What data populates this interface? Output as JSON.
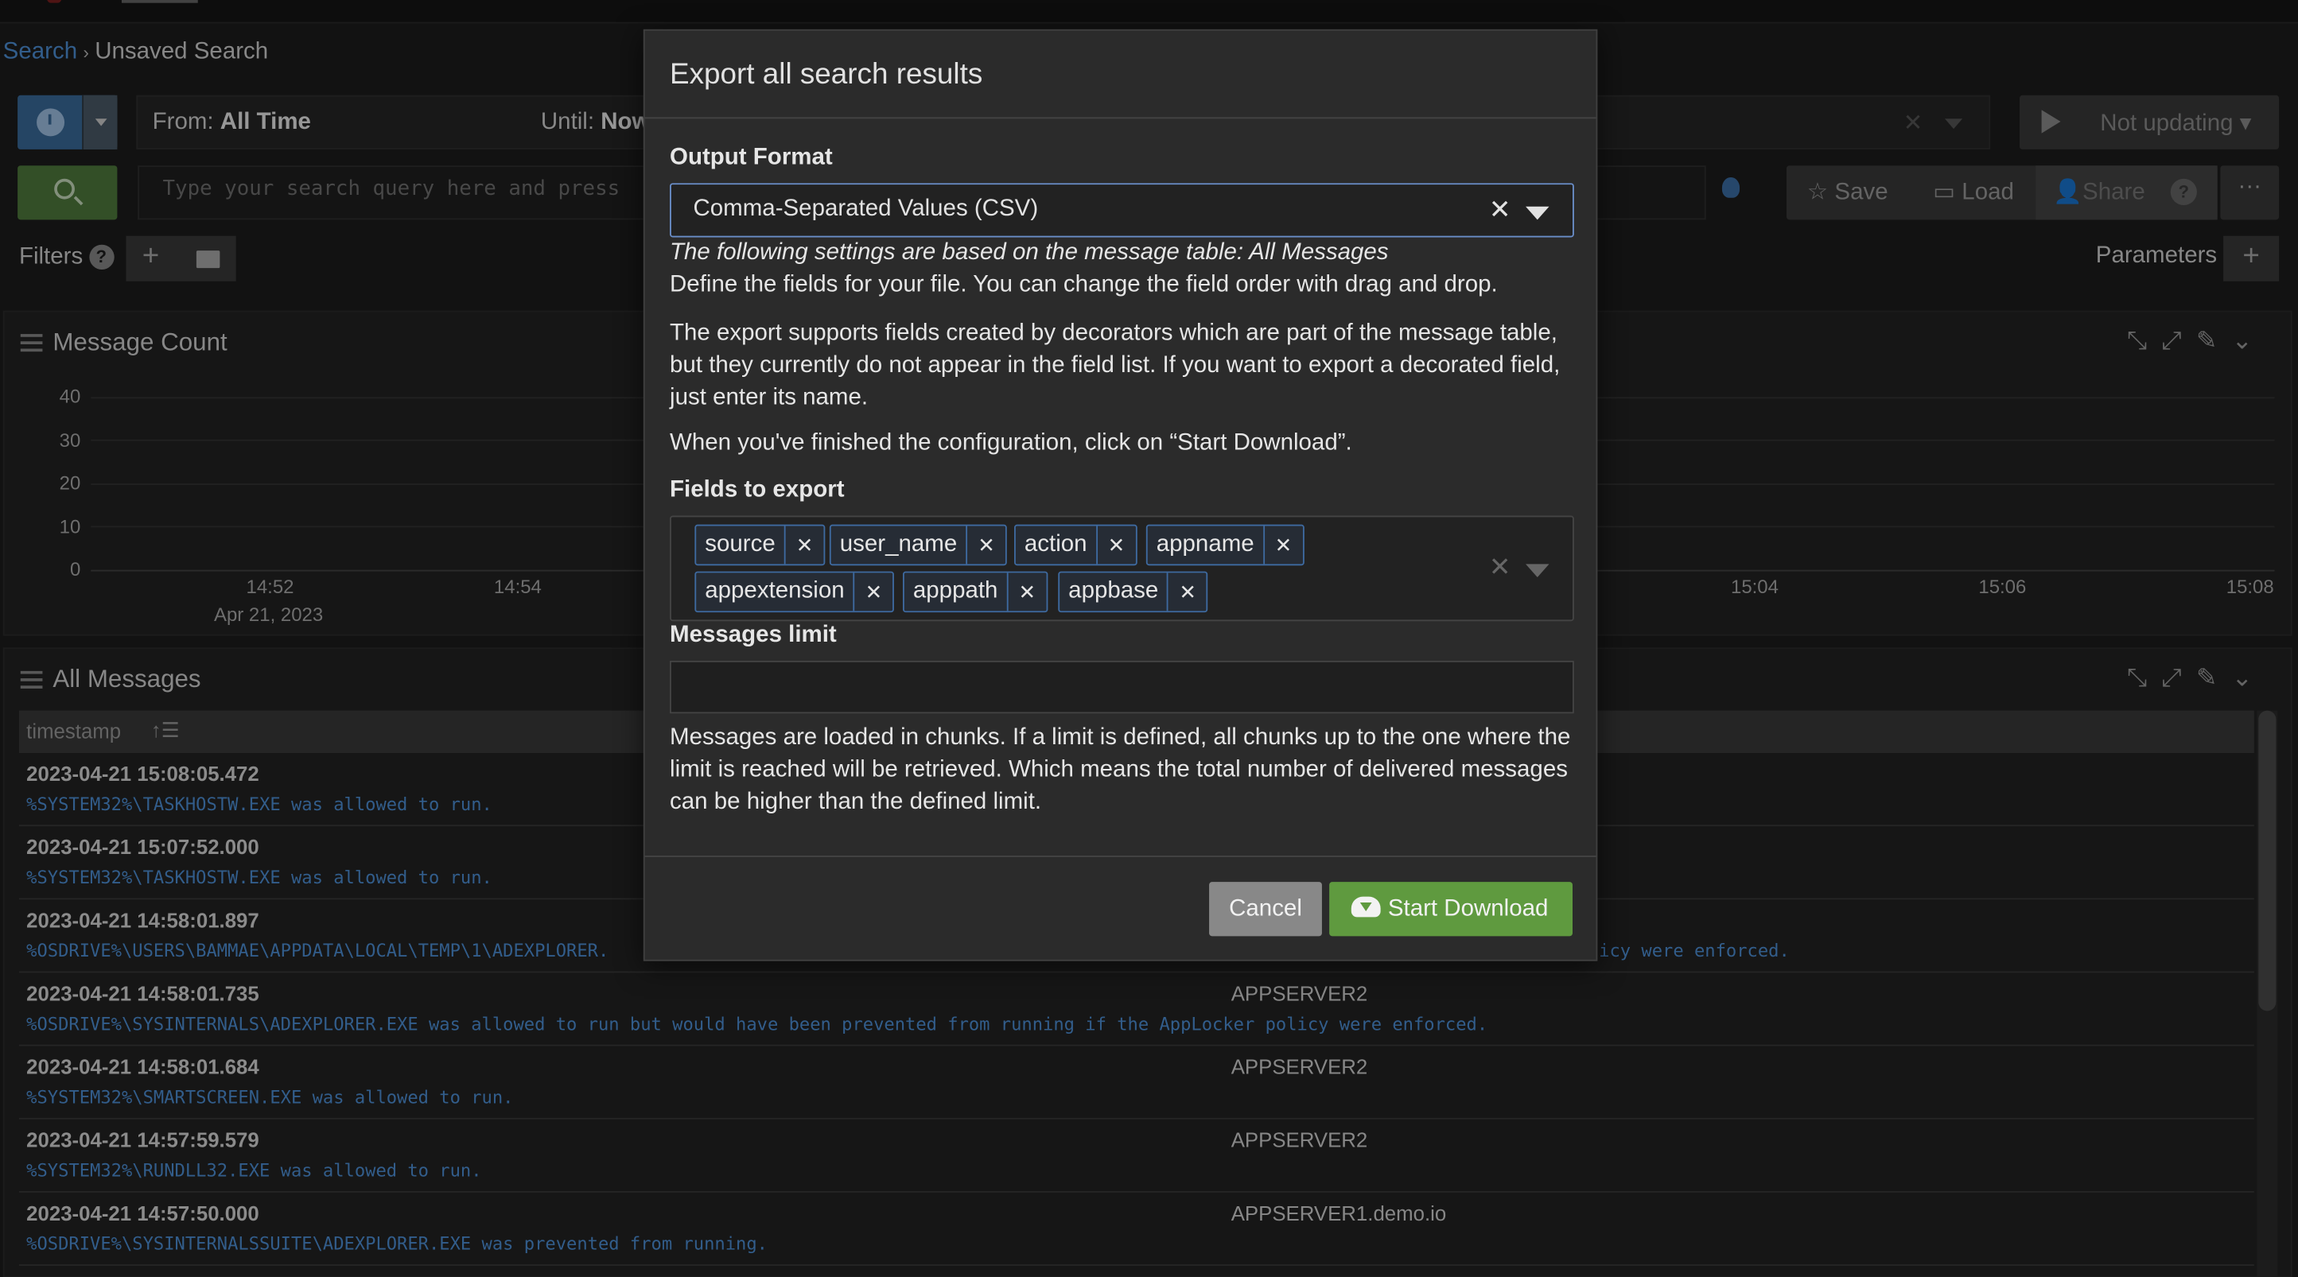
{
  "breadcrumb": {
    "root": "Search",
    "current": "Unsaved Search"
  },
  "timerange": {
    "from_label": "From:",
    "from_value": "All Time",
    "until_label": "Until:",
    "until_value": "Now"
  },
  "refresh": {
    "label": "Not updating"
  },
  "search": {
    "placeholder": "Type your search query here and press"
  },
  "actions": {
    "save": "Save",
    "load": "Load",
    "share": "Share",
    "help": "?",
    "more": "···"
  },
  "filters": {
    "label": "Filters",
    "help": "?"
  },
  "parameters": {
    "label": "Parameters"
  },
  "message_count": {
    "title": "Message Count",
    "y_ticks": [
      "40",
      "30",
      "20",
      "10",
      "0"
    ],
    "x_ticks": [
      "14:52",
      "14:54",
      "15:04",
      "15:06",
      "15:08"
    ],
    "x_date": "Apr 21, 2023"
  },
  "all_messages": {
    "title": "All Messages",
    "column": "timestamp",
    "rows": [
      {
        "ts": "2023-04-21 15:08:05.472",
        "msg": "%SYSTEM32%\\TASKHOSTW.EXE was allowed to run.",
        "src": ""
      },
      {
        "ts": "2023-04-21 15:07:52.000",
        "msg": "%SYSTEM32%\\TASKHOSTW.EXE was allowed to run.",
        "src": ""
      },
      {
        "ts": "2023-04-21 14:58:01.897",
        "msg": "%OSDRIVE%\\USERS\\BAMMAE\\APPDATA\\LOCAL\\TEMP\\1\\ADEXPLORER.",
        "src": ""
      },
      {
        "ts": "2023-04-21 14:58:01.735",
        "msg": "%OSDRIVE%\\SYSINTERNALS\\ADEXPLORER.EXE was allowed to run but would have been prevented from running if the AppLocker policy were enforced.",
        "src": "APPSERVER2"
      },
      {
        "ts": "2023-04-21 14:58:01.684",
        "msg": "%SYSTEM32%\\SMARTSCREEN.EXE was allowed to run.",
        "src": "APPSERVER2"
      },
      {
        "ts": "2023-04-21 14:57:59.579",
        "msg": "%SYSTEM32%\\RUNDLL32.EXE was allowed to run.",
        "src": "APPSERVER2"
      },
      {
        "ts": "2023-04-21 14:57:50.000",
        "msg": "%OSDRIVE%\\SYSINTERNALSSUITE\\ADEXPLORER.EXE was prevented from running.",
        "src": "APPSERVER1.demo.io"
      }
    ],
    "row3_tail": "icy were enforced."
  },
  "modal": {
    "title": "Export all search results",
    "output_format_label": "Output Format",
    "output_format_value": "Comma-Separated Values (CSV)",
    "note_italic": "The following settings are based on the message table: All Messages",
    "note_define": "Define the fields for your file. You can change the field order with drag and drop.",
    "note_decorators": "The export supports fields created by decorators which are part of the message table, but they currently do not appear in the field list. If you want to export a decorated field, just enter its name.",
    "note_finish": "When you've finished the configuration, click on “Start Download”.",
    "fields_label": "Fields to export",
    "fields": [
      "source",
      "user_name",
      "action",
      "appname",
      "appextension",
      "apppath",
      "appbase"
    ],
    "limit_label": "Messages limit",
    "limit_value": "",
    "limit_help": "Messages are loaded in chunks. If a limit is defined, all chunks up to the one where the limit is reached will be retrieved. Which means the total number of delivered messages can be higher than the defined limit.",
    "cancel": "Cancel",
    "start_download": "Start Download"
  },
  "colors": {
    "link": "#4d8fd6",
    "primary": "#5f9a3f",
    "focus_border": "#6a8ec9"
  }
}
